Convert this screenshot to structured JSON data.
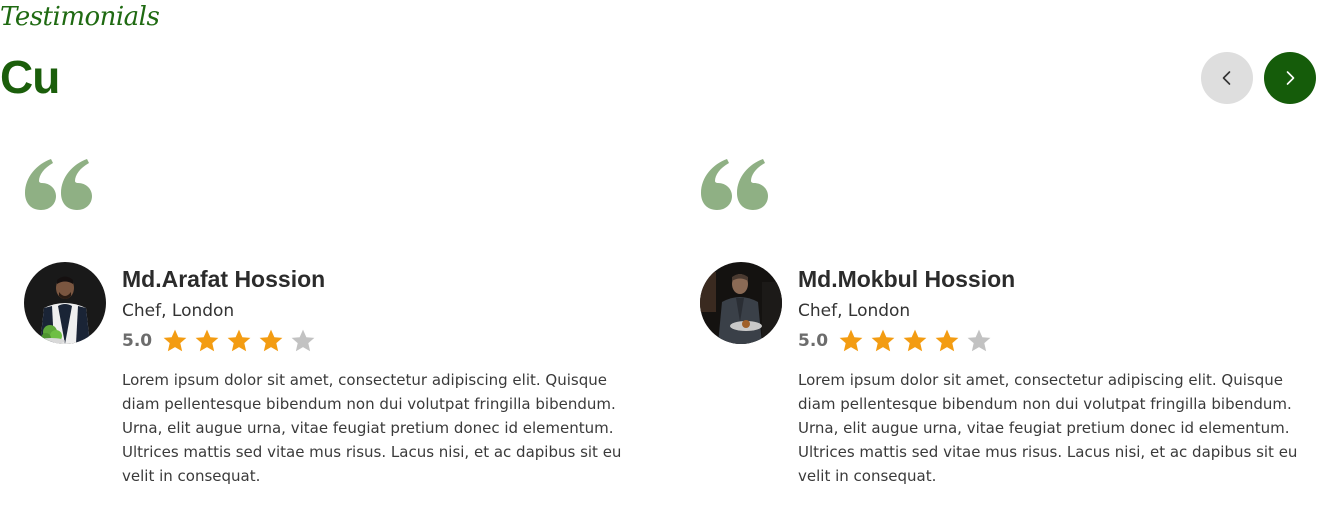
{
  "section": {
    "eyebrow": "Testimonials",
    "heading": "Cu",
    "accent_color": "#155c0a",
    "quote_color": "#8fb084",
    "star_filled_color": "#f39c12",
    "star_empty_color": "#c2c2c2"
  },
  "navigation": {
    "prev_icon": "chevron-left-icon",
    "next_icon": "chevron-right-icon"
  },
  "testimonials": [
    {
      "name": "Md.Arafat Hossion",
      "role": "Chef, London",
      "rating_label": "5.0",
      "stars_filled": 4,
      "stars_total": 5,
      "text": "Lorem ipsum dolor sit amet, consectetur adipiscing elit. Quisque diam pellentesque bibendum non dui volutpat fringilla bibendum. Urna, elit augue urna, vitae feugiat pretium donec id elementum. Ultrices mattis sed vitae mus risus. Lacus nisi, et ac dapibus sit eu velit in consequat."
    },
    {
      "name": "Md.Mokbul Hossion",
      "role": "Chef, London",
      "rating_label": "5.0",
      "stars_filled": 4,
      "stars_total": 5,
      "text": "Lorem ipsum dolor sit amet, consectetur adipiscing elit. Quisque diam pellentesque bibendum non dui volutpat fringilla bibendum. Urna, elit augue urna, vitae feugiat pretium donec id elementum. Ultrices mattis sed vitae mus risus. Lacus nisi, et ac dapibus sit eu velit in consequat."
    }
  ]
}
